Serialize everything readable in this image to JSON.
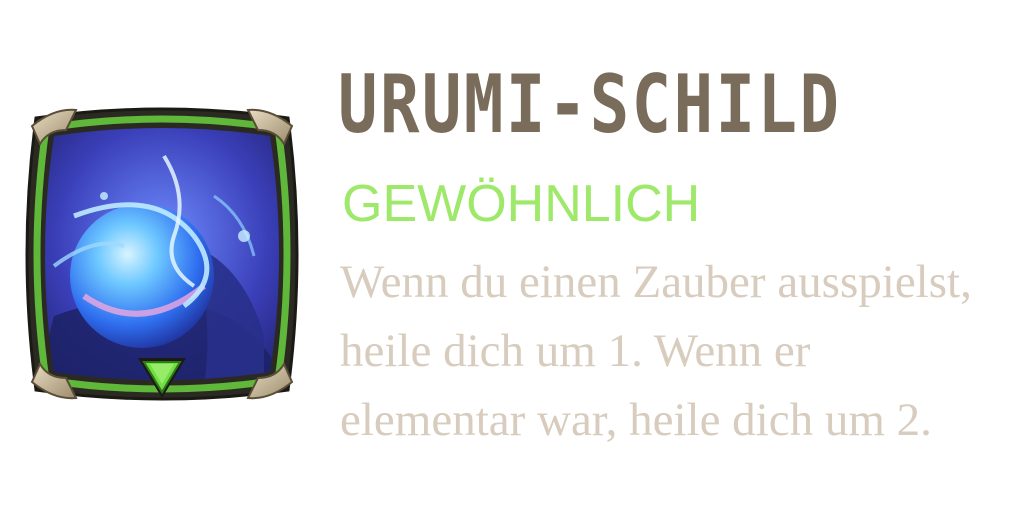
{
  "item": {
    "name": "URUMI-SCHILD",
    "rarity": "GEWÖHNLICH",
    "description": "Wenn du einen Zauber ausspielst, heile dich um 1. Wenn er elementar war, heile dich um 2."
  },
  "icon": {
    "name": "water-orb-icon",
    "rarity_marker": "green-triangle-icon"
  },
  "colors": {
    "title": "#7a6c5a",
    "rarity": "#9ee86a",
    "description": "#d7ccbd",
    "frame_green": "#5fb83a",
    "frame_dark": "#2b2a22",
    "orb_blue": "#3f6df0"
  }
}
